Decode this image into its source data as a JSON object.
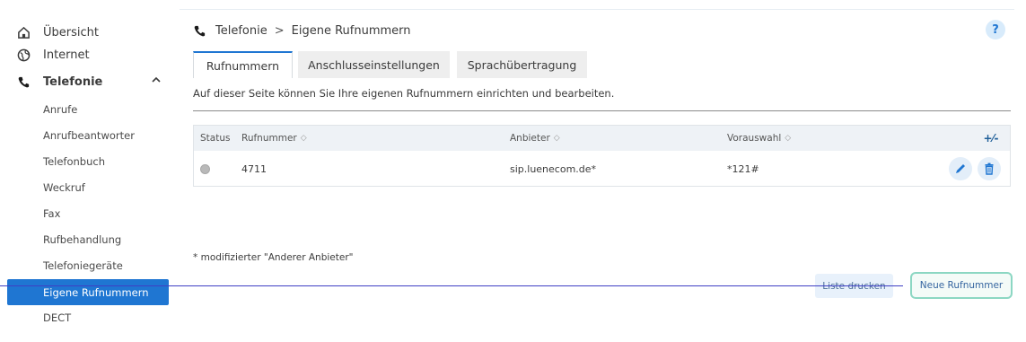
{
  "sidebar": {
    "main_items": [
      {
        "label": "Übersicht",
        "icon": "home-icon"
      },
      {
        "label": "Internet",
        "icon": "globe-icon"
      },
      {
        "label": "Telefonie",
        "icon": "phone-icon"
      }
    ],
    "sub_items": [
      "Anrufe",
      "Anrufbeantworter",
      "Telefonbuch",
      "Weckruf",
      "Fax",
      "Rufbehandlung",
      "Telefoniegeräte",
      "Eigene Rufnummern",
      "DECT"
    ],
    "active_item": "Eigene Rufnummern"
  },
  "header": {
    "section": "Telefonie",
    "separator": ">",
    "page": "Eigene Rufnummern",
    "help_label": "?"
  },
  "tabs": [
    {
      "label": "Rufnummern",
      "active": true
    },
    {
      "label": "Anschlusseinstellungen",
      "active": false
    },
    {
      "label": "Sprachübertragung",
      "active": false
    }
  ],
  "intro_text": "Auf dieser Seite können Sie Ihre eigenen Rufnummern einrichten und bearbeiten.",
  "table": {
    "columns": {
      "status": "Status",
      "number": "Rufnummer",
      "provider": "Anbieter",
      "preselect": "Vorauswahl"
    },
    "rows": [
      {
        "number": "4711",
        "provider": "sip.luenecom.de*",
        "preselect": "*121#",
        "status": "inactive"
      }
    ],
    "header_action_symbol": "+⁄-"
  },
  "footnote": "* modifizierter \"Anderer Anbieter\"",
  "buttons": {
    "print": "Liste drucken",
    "new_number": "Neue Rufnummer"
  },
  "colors": {
    "accent": "#1f76d2",
    "new_button_border": "#8cd7c3",
    "status_inactive": "#b9b9b9"
  }
}
